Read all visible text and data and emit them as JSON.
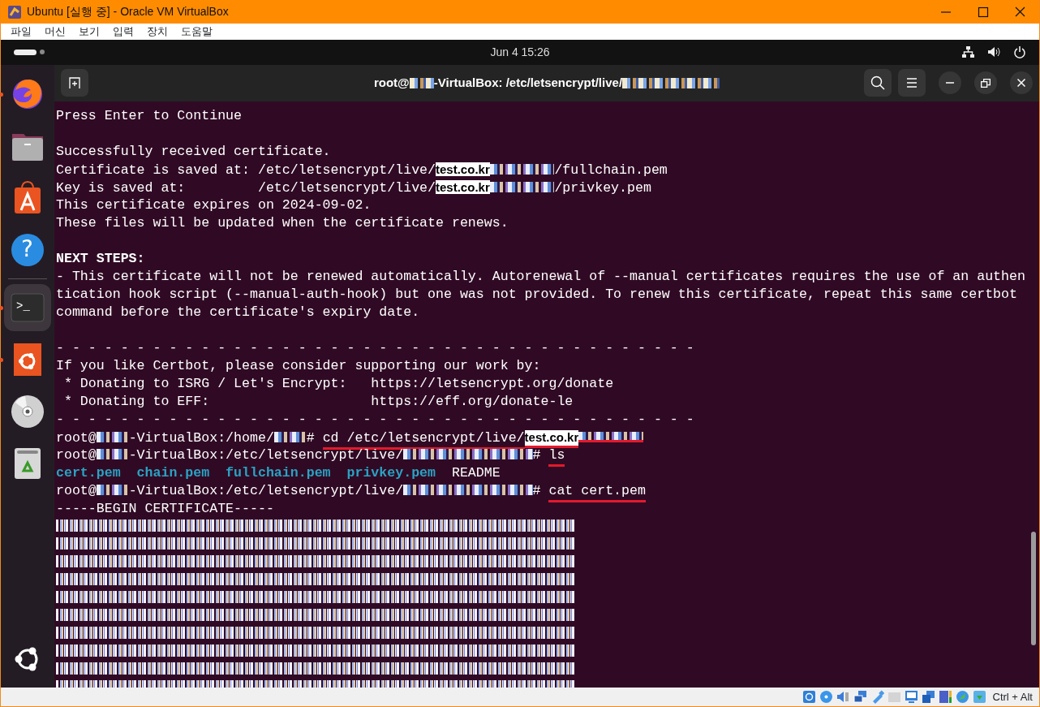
{
  "window": {
    "title": "Ubuntu [실행 중] - Oracle VM VirtualBox"
  },
  "menu": [
    "파일",
    "머신",
    "보기",
    "입력",
    "장치",
    "도움말"
  ],
  "top_bar": {
    "clock": "Jun 4  15:26"
  },
  "dock": [
    {
      "running": true,
      "selected": false
    },
    {
      "running": false,
      "selected": false
    },
    {
      "running": false,
      "selected": false
    },
    {
      "running": false,
      "selected": false,
      "glyph": "?"
    },
    {
      "running": true,
      "selected": true,
      "glyph": ">_"
    },
    {
      "running": true,
      "selected": false
    },
    {
      "running": false,
      "selected": false
    },
    {
      "running": false,
      "selected": false
    }
  ],
  "terminal": {
    "title": [
      {
        "kind": "text",
        "text": "root@"
      },
      {
        "kind": "redacted_short"
      },
      {
        "kind": "text",
        "text": "-VirtualBox: /etc/letsencrypt/live/"
      },
      {
        "kind": "redacted_long"
      }
    ],
    "lines": [
      {
        "kind": "plain",
        "text": "Press Enter to Continue"
      },
      {
        "kind": "blank"
      },
      {
        "kind": "plain",
        "text": "Successfully received certificate."
      },
      {
        "kind": "segments",
        "segments": [
          {
            "kind": "text",
            "text": "Certificate is saved at: /etc/letsencrypt/live/",
            "underlined": false
          },
          {
            "kind": "highlight",
            "text": "test.co.kr",
            "underlined": false
          },
          {
            "kind": "redacted_medium",
            "underlined": false
          },
          {
            "kind": "text",
            "text": "/fullchain.pem",
            "underlined": false
          }
        ]
      },
      {
        "kind": "segments",
        "segments": [
          {
            "kind": "text",
            "text": "Key is saved at:         /etc/letsencrypt/live/",
            "underlined": false
          },
          {
            "kind": "highlight",
            "text": "test.co.kr",
            "underlined": false
          },
          {
            "kind": "redacted_medium",
            "underlined": false
          },
          {
            "kind": "text",
            "text": "/privkey.pem",
            "underlined": false
          }
        ]
      },
      {
        "kind": "plain",
        "text": "This certificate expires on 2024-09-02."
      },
      {
        "kind": "plain",
        "text": "These files will be updated when the certificate renews."
      },
      {
        "kind": "blank"
      },
      {
        "kind": "bold",
        "text": "NEXT STEPS:"
      },
      {
        "kind": "plain",
        "text": "- This certificate will not be renewed automatically. Autorenewal of --manual certificates requires the use of an authen"
      },
      {
        "kind": "plain",
        "text": "tication hook script (--manual-auth-hook) but one was not provided. To renew this certificate, repeat this same certbot"
      },
      {
        "kind": "plain",
        "text": "command before the certificate's expiry date."
      },
      {
        "kind": "blank"
      },
      {
        "kind": "plain",
        "text": "- - - - - - - - - - - - - - - - - - - - - - - - - - - - - - - - - - - - - - - -"
      },
      {
        "kind": "plain",
        "text": "If you like Certbot, please consider supporting our work by:"
      },
      {
        "kind": "plain",
        "text": " * Donating to ISRG / Let's Encrypt:   https://letsencrypt.org/donate"
      },
      {
        "kind": "plain",
        "text": " * Donating to EFF:                    https://eff.org/donate-le"
      },
      {
        "kind": "plain",
        "text": "- - - - - - - - - - - - - - - - - - - - - - - - - - - - - - - - - - - - - - - -"
      },
      {
        "kind": "segments",
        "segments": [
          {
            "kind": "text",
            "text": "root@",
            "underlined": false
          },
          {
            "kind": "redacted_short",
            "underlined": false
          },
          {
            "kind": "text",
            "text": "-VirtualBox:/home/",
            "underlined": false
          },
          {
            "kind": "redacted_short",
            "underlined": false
          },
          {
            "kind": "text",
            "text": "# ",
            "underlined": false
          },
          {
            "kind": "text",
            "text": "cd /etc/letsencrypt/live/",
            "underlined": true
          },
          {
            "kind": "highlight",
            "text": "test.co.kr",
            "underlined": true
          },
          {
            "kind": "redacted_medium",
            "underlined": true
          }
        ]
      },
      {
        "kind": "segments",
        "segments": [
          {
            "kind": "text",
            "text": "root@",
            "underlined": false
          },
          {
            "kind": "redacted_short",
            "underlined": false
          },
          {
            "kind": "text",
            "text": "-VirtualBox:/etc/letsencrypt/live/",
            "underlined": false
          },
          {
            "kind": "redacted_long",
            "underlined": false
          },
          {
            "kind": "text",
            "text": "# ",
            "underlined": false
          },
          {
            "kind": "text",
            "text": "ls",
            "underlined": true
          }
        ]
      },
      {
        "kind": "listing",
        "files": [
          {
            "kind": "dir",
            "text": "cert.pem"
          },
          {
            "kind": "dir",
            "text": "chain.pem"
          },
          {
            "kind": "dir",
            "text": "fullchain.pem"
          },
          {
            "kind": "dir",
            "text": "privkey.pem"
          },
          {
            "kind": "file",
            "text": "README"
          }
        ]
      },
      {
        "kind": "segments",
        "segments": [
          {
            "kind": "text",
            "text": "root@",
            "underlined": false
          },
          {
            "kind": "redacted_short",
            "underlined": false
          },
          {
            "kind": "text",
            "text": "-VirtualBox:/etc/letsencrypt/live/",
            "underlined": false
          },
          {
            "kind": "redacted_long",
            "underlined": false
          },
          {
            "kind": "text",
            "text": "# ",
            "underlined": false
          },
          {
            "kind": "text",
            "text": "cat cert.pem",
            "underlined": true
          }
        ]
      },
      {
        "kind": "plain",
        "text": "-----BEGIN CERTIFICATE-----"
      },
      {
        "kind": "redacted"
      },
      {
        "kind": "redacted"
      },
      {
        "kind": "redacted"
      },
      {
        "kind": "redacted"
      },
      {
        "kind": "redacted"
      },
      {
        "kind": "redacted"
      },
      {
        "kind": "redacted"
      },
      {
        "kind": "redacted"
      },
      {
        "kind": "redacted"
      },
      {
        "kind": "redacted"
      }
    ]
  },
  "status_bar": {
    "host_key": "Ctrl + Alt"
  }
}
